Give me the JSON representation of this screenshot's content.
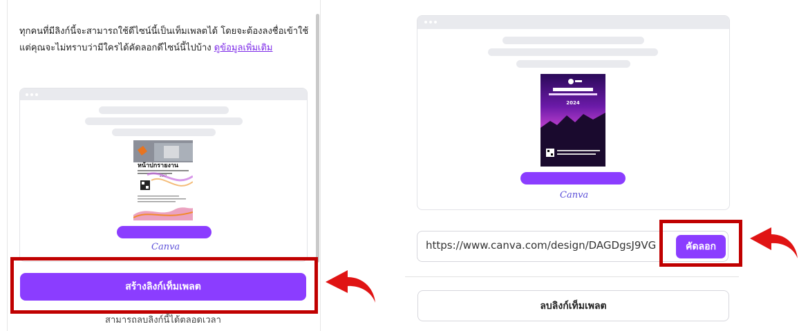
{
  "left": {
    "description_text": "ทุกคนที่มีลิงก์นี้จะสามารถใช้ดีไซน์นี้เป็นเท็มเพลตได้ โดยจะต้องลงชื่อเข้าใช้ แต่คุณจะไม่ทราบว่ามีใครได้คัดลอกดีไซน์นี้ไปบ้าง",
    "learn_more_link": "ดูข้อมูลเพิ่มเติม",
    "preview": {
      "thumbnail_title": "หน้าปกรายงาน",
      "thumbnail_year": "2567",
      "brand_logo": "Canva"
    },
    "create_link_button": "สร้างลิงก์เท็มเพลต",
    "note": "สามารถลบลิงก์นี้ได้ตลอดเวลา"
  },
  "right": {
    "preview": {
      "thumbnail_year": "2024",
      "brand_logo": "Canva"
    },
    "url_value": "https://www.canva.com/design/DAGDgsJ9VG",
    "copy_button": "คัดลอก",
    "delete_link_button": "ลบลิงก์เท็มเพลต"
  },
  "colors": {
    "accent_purple": "#8b3dff",
    "highlight_red": "#c00000",
    "arrow_red": "#e01414"
  },
  "icons": [
    "curved-arrow-left-icon",
    "curved-arrow-left-icon"
  ]
}
